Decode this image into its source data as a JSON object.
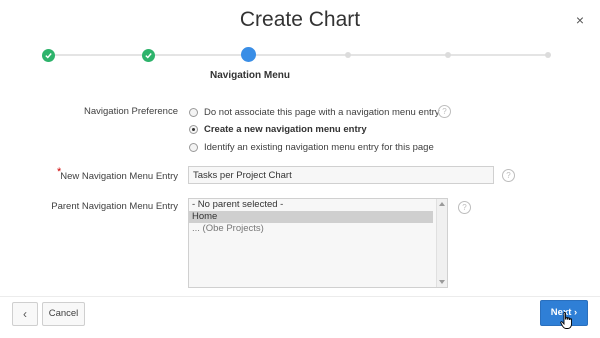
{
  "dialog": {
    "title": "Create Chart",
    "close_icon": "close-icon",
    "close_glyph": "×"
  },
  "wizard": {
    "steps": [
      {
        "state": "done"
      },
      {
        "state": "done"
      },
      {
        "state": "current",
        "label": "Navigation Menu"
      },
      {
        "state": "future"
      },
      {
        "state": "future"
      },
      {
        "state": "future"
      }
    ],
    "done_color": "#2db36b",
    "current_color": "#3a8ee6"
  },
  "form": {
    "navigation_preference": {
      "label": "Navigation Preference",
      "options": [
        {
          "label": "Do not associate this page with a navigation menu entry",
          "checked": false
        },
        {
          "label": "Create a new navigation menu entry",
          "checked": true
        },
        {
          "label": "Identify an existing navigation menu entry for this page",
          "checked": false
        }
      ],
      "help_glyph": "?"
    },
    "new_entry": {
      "label": "New Navigation Menu Entry",
      "required_marker": "*",
      "value": "Tasks per Project Chart",
      "help_glyph": "?"
    },
    "parent_entry": {
      "label": "Parent Navigation Menu Entry",
      "options": [
        {
          "label": "- No parent selected -",
          "selected": false
        },
        {
          "label": "Home",
          "selected": true
        },
        {
          "label": "... (Obe Projects)",
          "selected": false
        }
      ],
      "help_glyph": "?"
    }
  },
  "footer": {
    "prev_glyph": "‹",
    "cancel_label": "Cancel",
    "next_label": "Next",
    "next_glyph": "›",
    "accent": "#2f7fd6"
  }
}
